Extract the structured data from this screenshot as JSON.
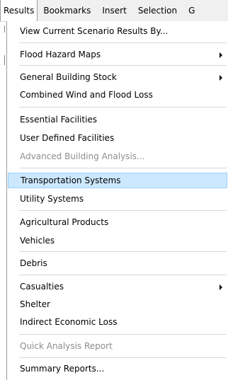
{
  "menubar": {
    "items": [
      {
        "label": "Results"
      },
      {
        "label": "Bookmarks"
      },
      {
        "label": "Insert"
      },
      {
        "label": "Selection"
      },
      {
        "label": "G"
      }
    ]
  },
  "dropdown": {
    "items": [
      {
        "label": "View Current Scenario Results By..."
      },
      {
        "label": "Flood Hazard Maps",
        "submenu": true
      },
      {
        "label": "General Building Stock",
        "submenu": true
      },
      {
        "label": "Combined Wind and Flood Loss"
      },
      {
        "label": "Essential Facilities"
      },
      {
        "label": "User Defined Facilities"
      },
      {
        "label": "Advanced Building Analysis...",
        "disabled": true
      },
      {
        "label": "Transportation Systems",
        "highlighted": true
      },
      {
        "label": "Utility Systems"
      },
      {
        "label": "Agricultural Products"
      },
      {
        "label": "Vehicles"
      },
      {
        "label": "Debris"
      },
      {
        "label": "Casualties",
        "submenu": true
      },
      {
        "label": "Shelter"
      },
      {
        "label": "Indirect Economic Loss"
      },
      {
        "label": "Quick Analysis Report",
        "disabled": true
      },
      {
        "label": "Summary Reports..."
      }
    ]
  }
}
